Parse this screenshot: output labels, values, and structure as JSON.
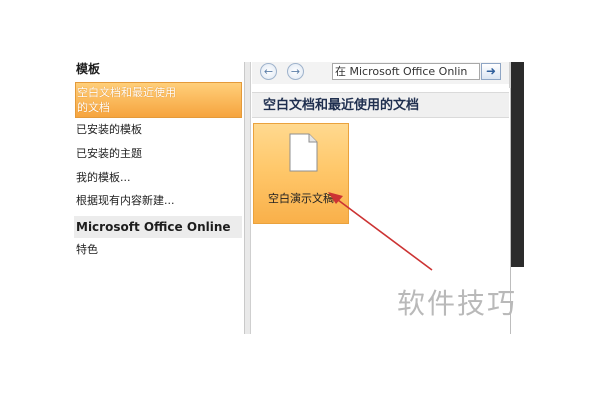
{
  "sidebar": {
    "templates_header": "模板",
    "selected_item": {
      "line1": "空白文档和最近使用",
      "line2": "的文档"
    },
    "items": [
      {
        "label": "已安装的模板"
      },
      {
        "label": "已安装的主题"
      },
      {
        "label": "我的模板..."
      },
      {
        "label": "根据现有内容新建..."
      }
    ],
    "online_header": "Microsoft Office Online",
    "online_items": [
      {
        "label": "特色"
      }
    ]
  },
  "toolbar": {
    "search_value": "在 Microsoft Office Onlin",
    "back_icon": "back-arrow-icon",
    "forward_icon": "forward-arrow-icon",
    "go_icon": "go-arrow-icon"
  },
  "gallery": {
    "header": "空白文档和最近使用的文档",
    "tile_label": "空白演示文稿",
    "tile_icon": "blank-document-icon"
  },
  "watermark": "软件技巧",
  "colors": {
    "selection": "#f6a43e",
    "annotation_arrow": "#cc3333"
  }
}
